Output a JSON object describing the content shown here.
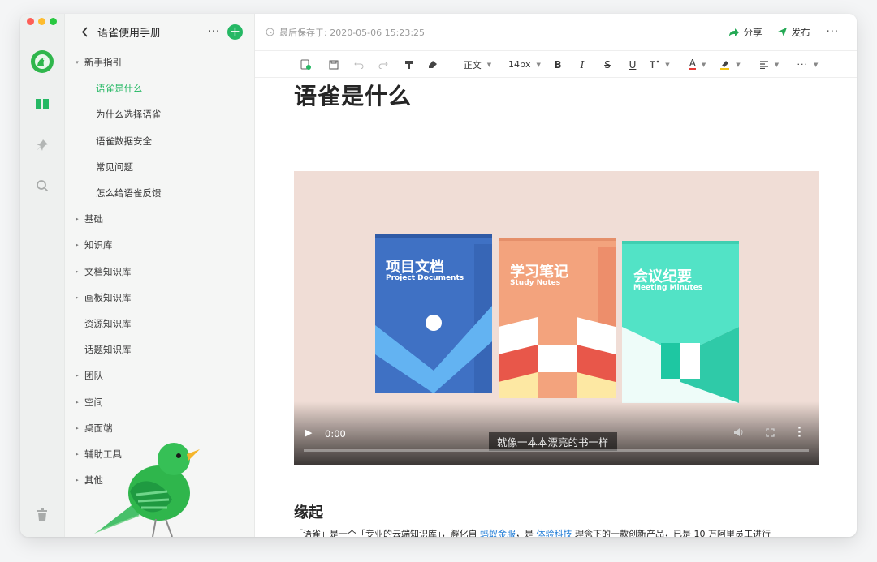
{
  "sidebar": {
    "title": "语雀使用手册",
    "more": "···",
    "add": "+",
    "items": [
      {
        "label": "新手指引",
        "level": 0,
        "caret": "▾"
      },
      {
        "label": "语雀是什么",
        "level": 1,
        "active": true
      },
      {
        "label": "为什么选择语雀",
        "level": 1
      },
      {
        "label": "语雀数据安全",
        "level": 1
      },
      {
        "label": "常见问题",
        "level": 1
      },
      {
        "label": "怎么给语雀反馈",
        "level": 1
      },
      {
        "label": "基础",
        "level": 0,
        "caret": "▸"
      },
      {
        "label": "知识库",
        "level": 0,
        "caret": "▸"
      },
      {
        "label": "文档知识库",
        "level": 0,
        "caret": "▸"
      },
      {
        "label": "画板知识库",
        "level": 0,
        "caret": "▸"
      },
      {
        "label": "资源知识库",
        "level": 0
      },
      {
        "label": "话题知识库",
        "level": 0
      },
      {
        "label": "团队",
        "level": 0,
        "caret": "▸"
      },
      {
        "label": "空间",
        "level": 0,
        "caret": "▸"
      },
      {
        "label": "桌面端",
        "level": 0,
        "caret": "▸"
      },
      {
        "label": "辅助工具",
        "level": 0,
        "caret": "▸"
      },
      {
        "label": "其他",
        "level": 0,
        "caret": "▸"
      }
    ]
  },
  "topbar": {
    "saved_label": "最后保存于: 2020-05-06 15:23:25",
    "share": "分享",
    "publish": "发布",
    "more": "···"
  },
  "toolbar": {
    "paragraph": "正文",
    "font_size": "14px",
    "bold": "B",
    "italic": "I",
    "strike": "S",
    "underline": "U",
    "color": "A",
    "more": "···"
  },
  "doc": {
    "title": "语雀是什么",
    "section_title": "缘起",
    "para_1": "「语雀」是一个「专业的云端知识库」，孵化自 ",
    "link_1": "蚂蚁金服",
    "para_2": "，是 ",
    "link_2": "体验科技",
    "para_3": " 理念下的一款创新产品，已是 10 万阿里员工进行"
  },
  "video": {
    "time": "0:00",
    "subtitle": "就像一本本漂亮的书一样",
    "progress": 0,
    "books": [
      {
        "title": "项目文档",
        "subtitle": "Project Documents",
        "color": "#5b8fde"
      },
      {
        "title": "学习笔记",
        "subtitle": "Study Notes",
        "color": "#f0a27e"
      },
      {
        "title": "会议纪要",
        "subtitle": "Meeting Minutes",
        "color": "#52e3c6"
      }
    ]
  },
  "colors": {
    "accent": "#25b864",
    "link": "#1f7cd6",
    "video_bg": "#f0ddd6"
  }
}
